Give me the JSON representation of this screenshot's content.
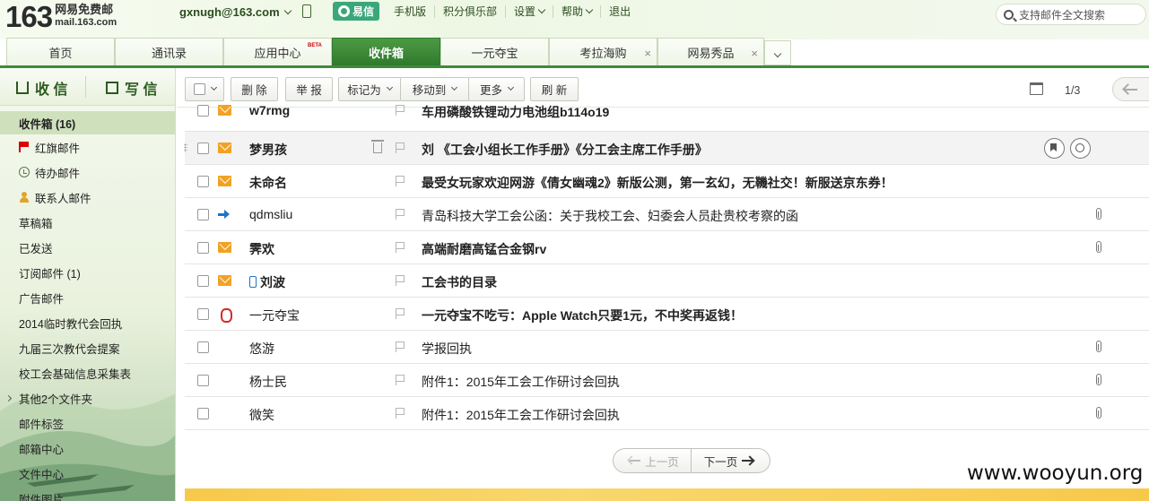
{
  "header": {
    "logo_number": "163",
    "logo_cn": "网易免费邮",
    "logo_domain": "mail.163.com",
    "user_email": "gxnugh@163.com",
    "yixin_label": "易信",
    "links": [
      "手机版",
      "积分俱乐部",
      "设置",
      "帮助",
      "退出"
    ],
    "search_placeholder": "支持邮件全文搜索"
  },
  "tabs": [
    {
      "label": "首页",
      "closable": false
    },
    {
      "label": "通讯录",
      "closable": false
    },
    {
      "label": "应用中心",
      "badge": "BETA",
      "closable": false
    },
    {
      "label": "收件箱",
      "active": true,
      "closable": false
    },
    {
      "label": "一元夺宝",
      "closable": false
    },
    {
      "label": "考拉海购",
      "closable": true
    },
    {
      "label": "网易秀品",
      "closable": true
    }
  ],
  "sidebar": {
    "receive_label": "收 信",
    "write_label": "写 信",
    "folders": [
      {
        "label": "收件箱 (16)",
        "active": true
      },
      {
        "label": "红旗邮件",
        "icon": "red-flag-icon"
      },
      {
        "label": "待办邮件",
        "icon": "clock-icon"
      },
      {
        "label": "联系人邮件",
        "icon": "person-icon"
      },
      {
        "label": "草稿箱"
      },
      {
        "label": "已发送"
      },
      {
        "label": "订阅邮件 (1)"
      },
      {
        "label": "广告邮件"
      },
      {
        "label": "2014临时教代会回执"
      },
      {
        "label": "九届三次教代会提案"
      },
      {
        "label": "校工会基础信息采集表"
      },
      {
        "label": "其他2个文件夹",
        "expandable": true
      },
      {
        "label": "邮件标签"
      },
      {
        "label": "邮箱中心"
      },
      {
        "label": "文件中心"
      },
      {
        "label": "附件图片"
      }
    ]
  },
  "toolbar": {
    "delete": "删 除",
    "report": "举 报",
    "mark_as": "标记为",
    "move_to": "移动到",
    "more": "更多",
    "refresh": "刷 新",
    "page_indicator": "1/3"
  },
  "mails": [
    {
      "sender": "w7rmg",
      "subject": "车用磷酸铁锂动力电池组b114o19",
      "unread": true,
      "state": "unread-envelope-icon",
      "attachment": false
    },
    {
      "sender": "梦男孩",
      "subject": "刘 《工会小组长工作手册》《分工会主席工作手册》",
      "unread": true,
      "state": "unread-envelope-icon",
      "attachment": false,
      "hover": true
    },
    {
      "sender": "未命名",
      "subject": "最受女玩家欢迎网游《倩女幽魂2》新版公测，第一玄幻，无鞿社交！新服送京东券！",
      "unread": true,
      "state": "unread-envelope-icon",
      "attachment": false
    },
    {
      "sender": "qdmsliu",
      "subject": "青岛科技大学工会公函：关于我校工会、妇委会人员赴贵校考察的函",
      "unread": false,
      "state": "replied-arrow-icon",
      "attachment": true
    },
    {
      "sender": "霁欢",
      "subject": "高端耐磨高锰合金钢rv",
      "unread": true,
      "state": "unread-envelope-icon",
      "attachment": true
    },
    {
      "sender": "刘波",
      "subject": "工会书的目录",
      "unread": true,
      "state": "unread-envelope-icon",
      "attachment": false,
      "mobile": true
    },
    {
      "sender": "一元夺宝",
      "subject": "一元夺宝不吃亏：Apple Watch只要1元，不中奖再返钱！",
      "unread": true,
      "state": "red-packet-icon",
      "attachment": false
    },
    {
      "sender": "悠游",
      "subject": "学报回执",
      "unread": false,
      "state": "",
      "attachment": true
    },
    {
      "sender": "杨士民",
      "subject": "附件1：2015年工会工作研讨会回执",
      "unread": false,
      "state": "",
      "attachment": true
    },
    {
      "sender": "微笑",
      "subject": "附件1：2015年工会工作研讨会回执",
      "unread": false,
      "state": "",
      "attachment": true
    }
  ],
  "pager": {
    "prev": "上一页",
    "next": "下一页"
  },
  "watermark": "www.wooyun.org",
  "colors": {
    "accent_green": "#3f8a3a",
    "unread_envelope": "#f2a223",
    "replied_arrow": "#1f73c4",
    "red_flag": "#d00000"
  }
}
